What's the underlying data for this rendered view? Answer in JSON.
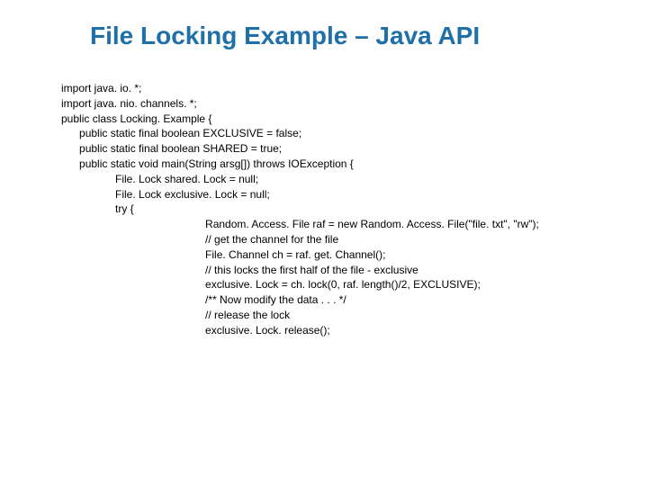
{
  "title": "File Locking Example – Java API",
  "code": {
    "l1": "import java. io. *;",
    "l2": "import java. nio. channels. *;",
    "l3": "public class Locking. Example {",
    "l4": "public static final boolean EXCLUSIVE = false;",
    "l5": "public static final boolean SHARED = true;",
    "l6": "public static void main(String arsg[]) throws IOException {",
    "l7": "File. Lock shared. Lock = null;",
    "l8": "File. Lock exclusive. Lock = null;",
    "l9": "try {",
    "l10": "Random. Access. File raf = new Random. Access. File(\"file. txt\", \"rw\");",
    "l11": "// get the channel for the file",
    "l12": "File. Channel ch = raf. get. Channel();",
    "l13": "// this locks the first half of the file - exclusive",
    "l14": "exclusive. Lock = ch. lock(0, raf. length()/2, EXCLUSIVE);",
    "l15": "/** Now modify the data . . . */",
    "l16": "// release the lock",
    "l17": "exclusive. Lock. release();"
  },
  "indent": {
    "i0": "",
    "i1": "      ",
    "i2": "                  ",
    "i3": "                                                "
  }
}
